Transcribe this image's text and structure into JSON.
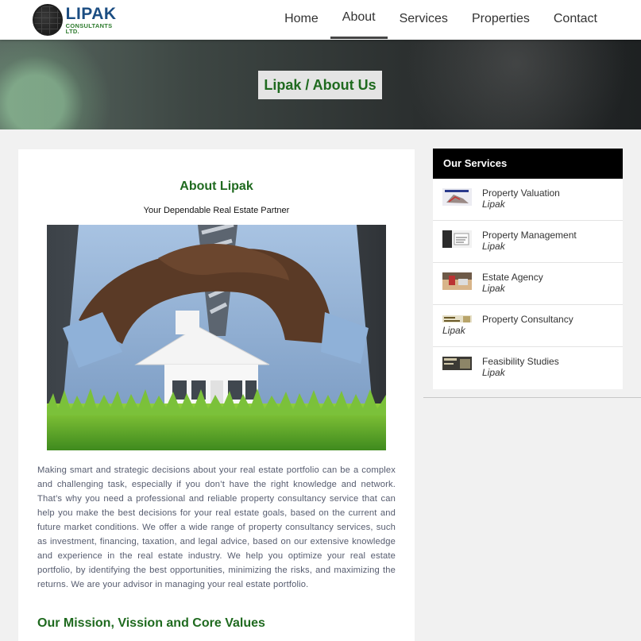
{
  "brand": {
    "name": "LIPAK",
    "subtitle": "CONSULTANTS LTD."
  },
  "nav": [
    {
      "label": "Home",
      "active": false
    },
    {
      "label": "About",
      "active": true
    },
    {
      "label": "Services",
      "active": false
    },
    {
      "label": "Properties",
      "active": false
    },
    {
      "label": "Contact",
      "active": false
    }
  ],
  "hero": {
    "title": "Lipak / About Us"
  },
  "main": {
    "title": "About Lipak",
    "subtitle": "Your Dependable Real Estate Partner",
    "paragraph": "Making smart and strategic decisions about your real estate portfolio can be a complex and challenging task, especially if you don’t have the right knowledge and network. That’s why you need a professional and reliable property consultancy service that can help you make the best decisions for your real estate goals, based on the current and future market conditions. We offer a wide range of property consultancy services, such as investment, financing, taxation, and legal advice, based on our extensive knowledge and experience in the real estate industry. We help you optimize your real estate portfolio, by identifying the best opportunities, minimizing the risks, and maximizing the returns. We are your advisor in managing your real estate portfolio.",
    "section_heading": "Our Mission, Vission and Core Values"
  },
  "sidebar": {
    "heading": "Our Services",
    "items": [
      {
        "name": "Property Valuation",
        "author": "Lipak"
      },
      {
        "name": "Property Management",
        "author": "Lipak"
      },
      {
        "name": "Estate Agency",
        "author": "Lipak"
      },
      {
        "name": "Property Consultancy",
        "author": "Lipak"
      },
      {
        "name": "Feasibility Studies",
        "author": "Lipak"
      }
    ]
  },
  "colors": {
    "accent_green": "#1f6a1f",
    "brand_blue": "#1b4d82",
    "sidebar_header": "#000000"
  }
}
